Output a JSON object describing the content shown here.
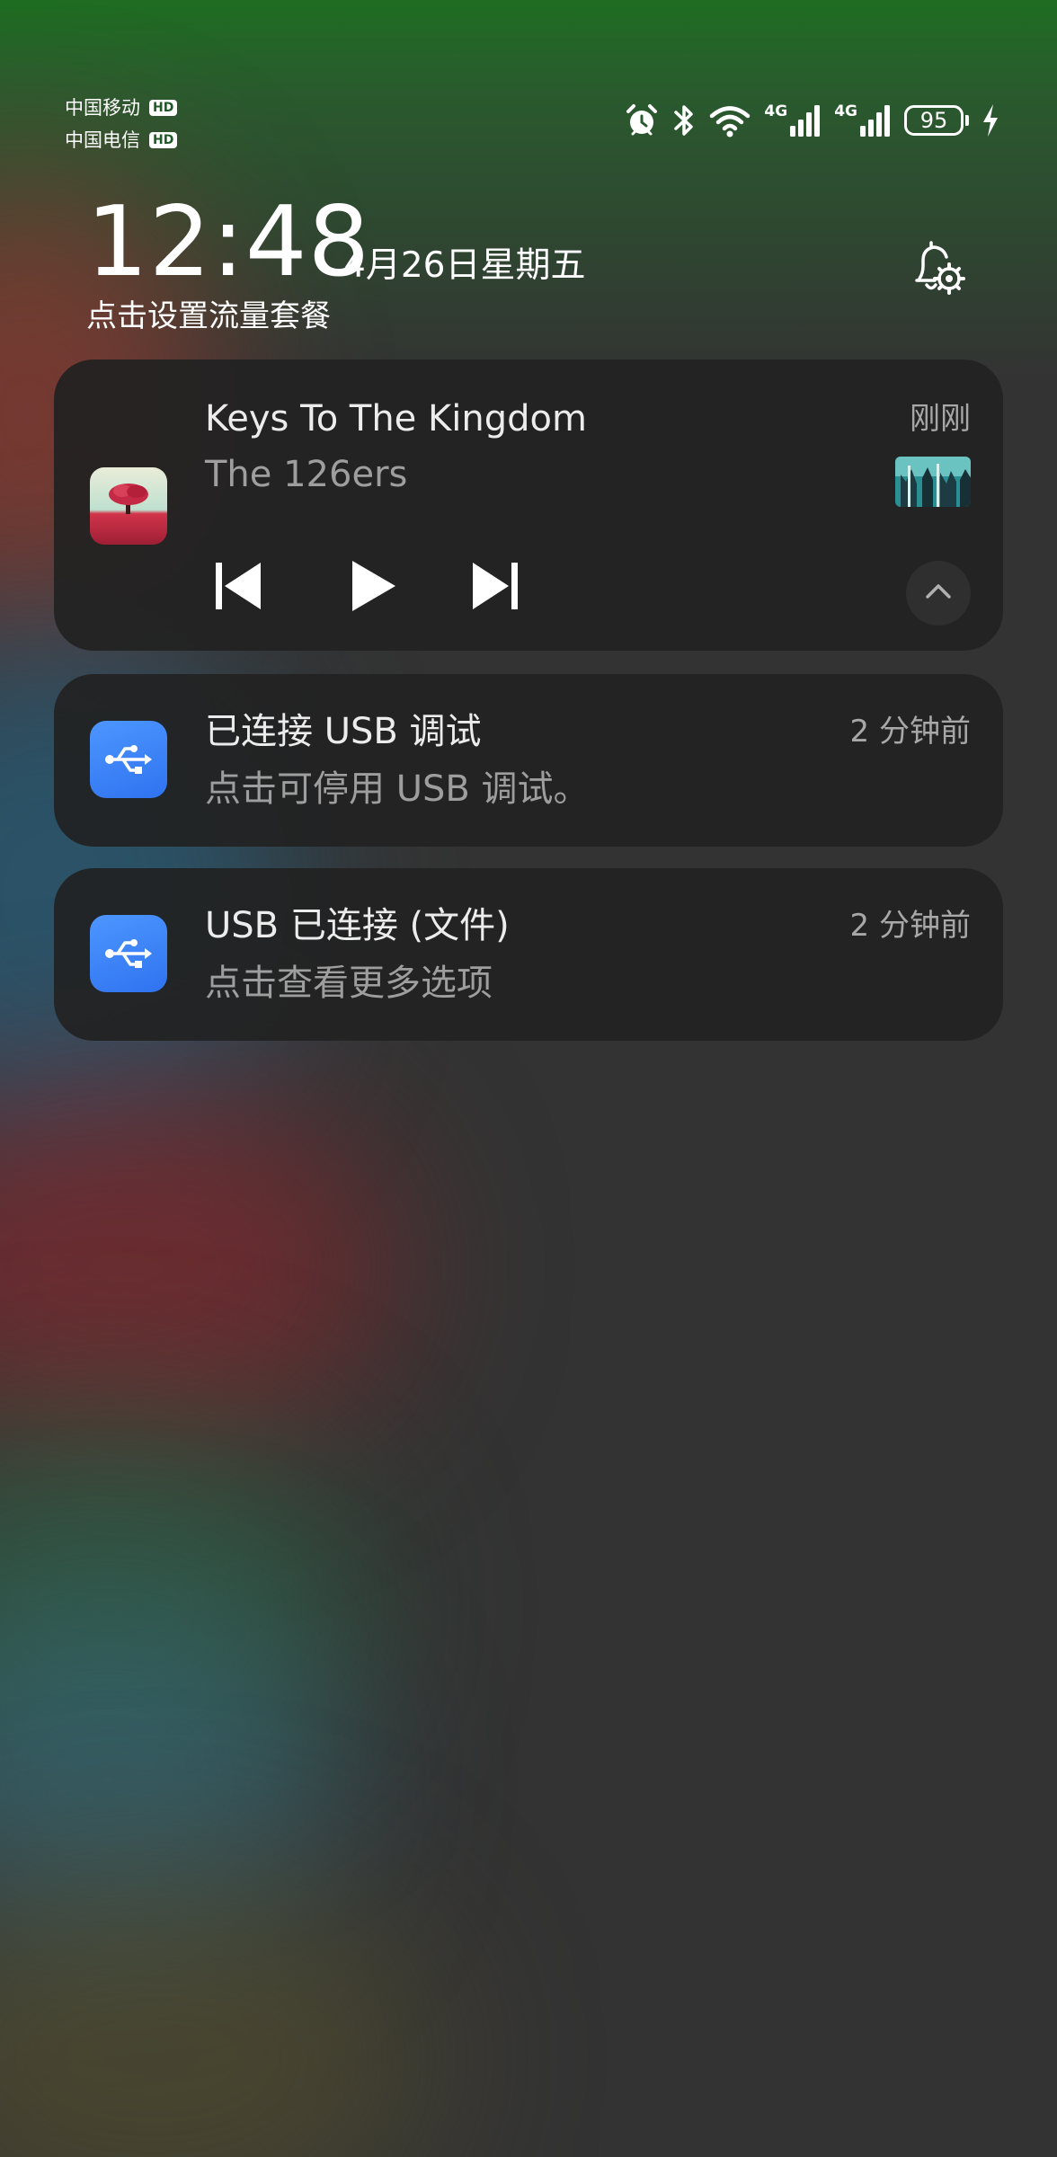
{
  "status_bar": {
    "carrier_1": "中国移动",
    "carrier_2": "中国电信",
    "hd_badge": "HD",
    "network_label_1": "4G",
    "network_label_2": "4G",
    "battery_level": "95",
    "icons": [
      "alarm-icon",
      "bluetooth-icon",
      "wifi-icon",
      "signal-icon",
      "signal-icon",
      "battery-icon",
      "charging-icon"
    ]
  },
  "header": {
    "time": "12:48",
    "date": "4月26日星期五",
    "data_plan_link": "点击设置流量套餐",
    "settings_icon": "bell-settings-icon"
  },
  "media_player": {
    "title": "Keys To The Kingdom",
    "artist": "The 126ers",
    "time": "刚刚",
    "controls": [
      "previous-icon",
      "play-icon",
      "next-icon",
      "chevron-up-icon"
    ]
  },
  "notifications": [
    {
      "icon": "usb-icon",
      "title": "已连接 USB 调试",
      "body": "点击可停用 USB 调试。",
      "time": "2 分钟前"
    },
    {
      "icon": "usb-icon",
      "title": "USB 已连接 (文件)",
      "body": "点击查看更多选项",
      "time": "2 分钟前"
    }
  ],
  "colors": {
    "status_bar_green": "#1f6d22",
    "card_background": "#222222",
    "usb_icon_blue": "#3b82f6",
    "primary_text": "#ececec",
    "secondary_text": "#9e9e9e"
  }
}
